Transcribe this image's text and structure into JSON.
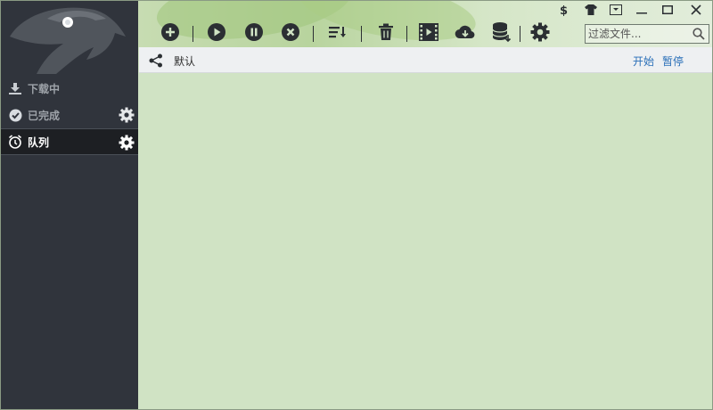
{
  "sidebar": {
    "items": [
      {
        "label": "下载中"
      },
      {
        "label": "已完成"
      },
      {
        "label": "队列"
      }
    ]
  },
  "search": {
    "placeholder": "过滤文件..."
  },
  "category": {
    "label": "默认",
    "start_label": "开始",
    "pause_label": "暂停"
  },
  "colors": {
    "sidebar_bg": "#30343c",
    "active_bg": "#1d1f23",
    "content_bg": "#d0e3c4",
    "link": "#2a6fb8"
  }
}
